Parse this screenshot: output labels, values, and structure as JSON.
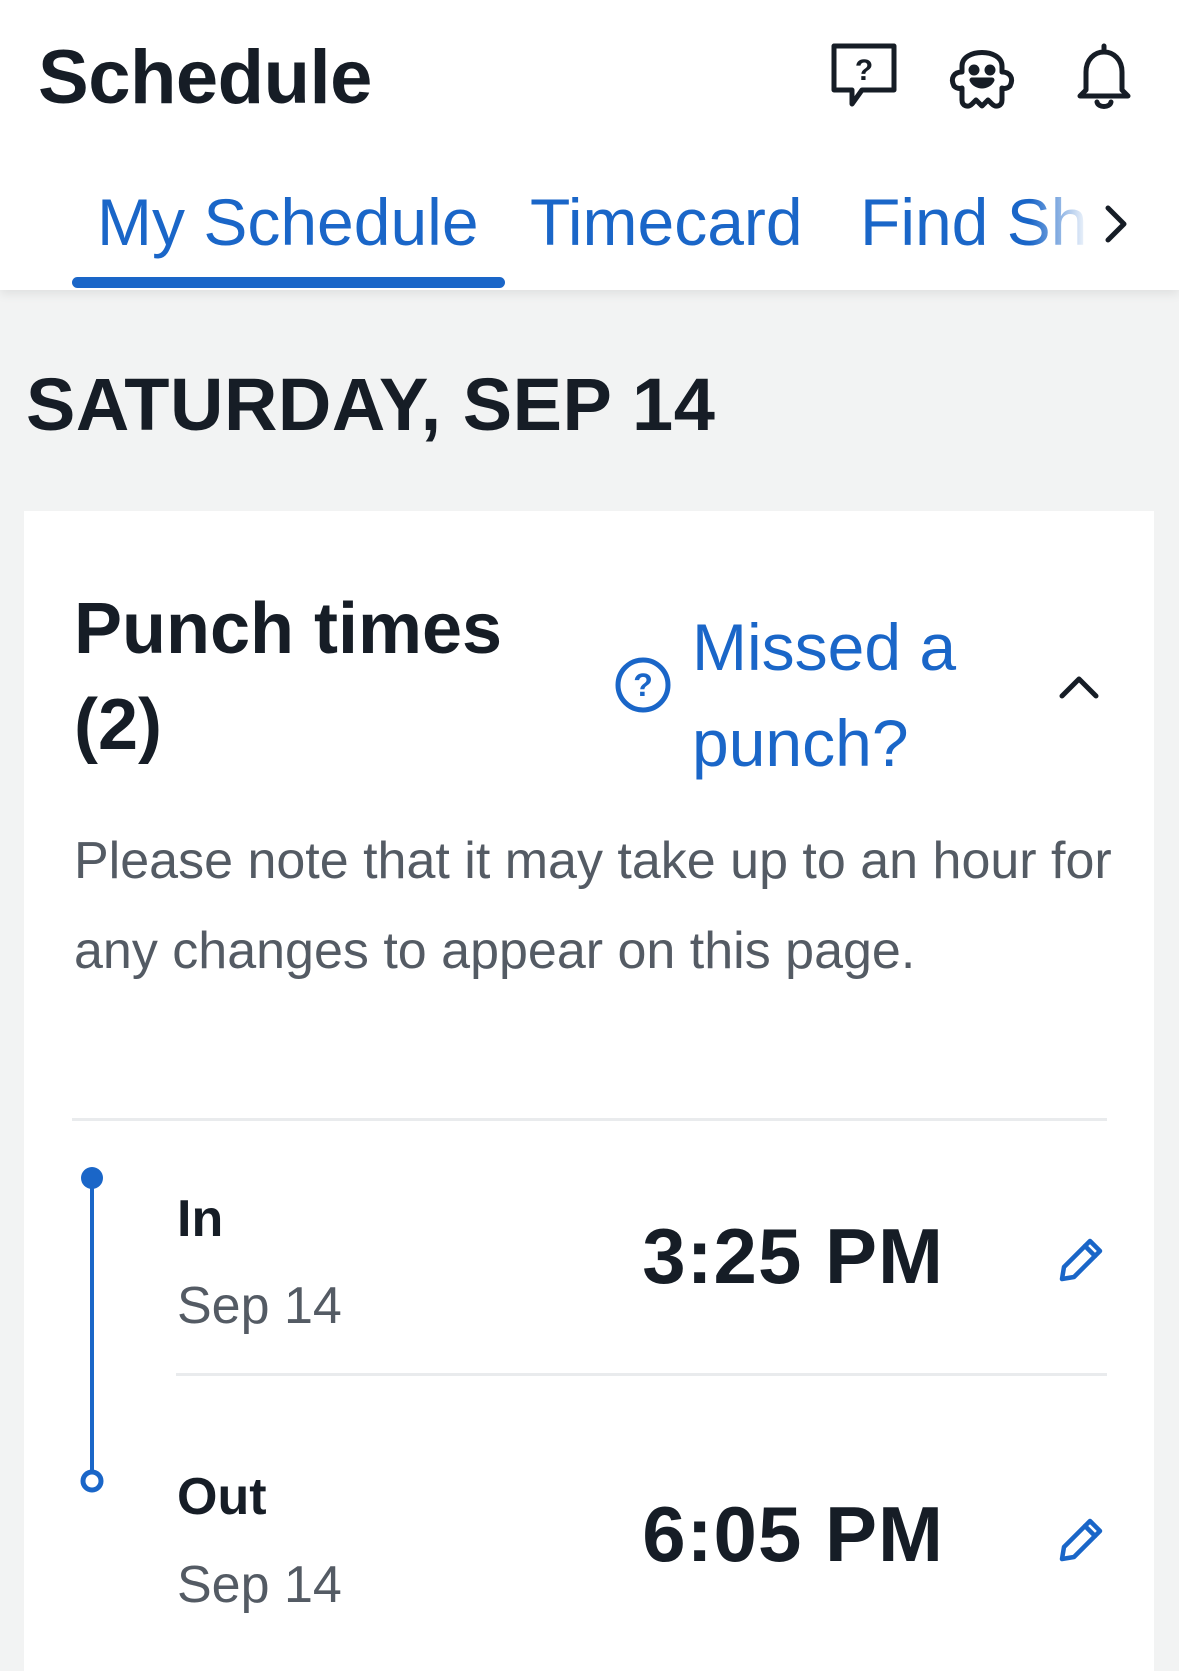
{
  "header": {
    "title": "Schedule",
    "icons": [
      "help-chat-icon",
      "mascot-icon",
      "bell-icon"
    ]
  },
  "tabs": [
    {
      "label": "My Schedule",
      "active": true
    },
    {
      "label": "Timecard",
      "active": false
    },
    {
      "label": "Find Sh",
      "active": false
    }
  ],
  "date_heading": "SATURDAY, SEP 14",
  "punch_card": {
    "title": "Punch times (2)",
    "missed_link": "Missed a punch?",
    "note": "Please note that it may take up to an hour for any changes to appear on this page.",
    "punches": [
      {
        "type": "In",
        "date": "Sep 14",
        "time": "3:25 PM"
      },
      {
        "type": "Out",
        "date": "Sep 14",
        "time": "6:05 PM"
      }
    ]
  },
  "colors": {
    "accent": "#1a66c8",
    "text": "#161d26",
    "muted": "#545b64",
    "background": "#f2f3f3"
  }
}
